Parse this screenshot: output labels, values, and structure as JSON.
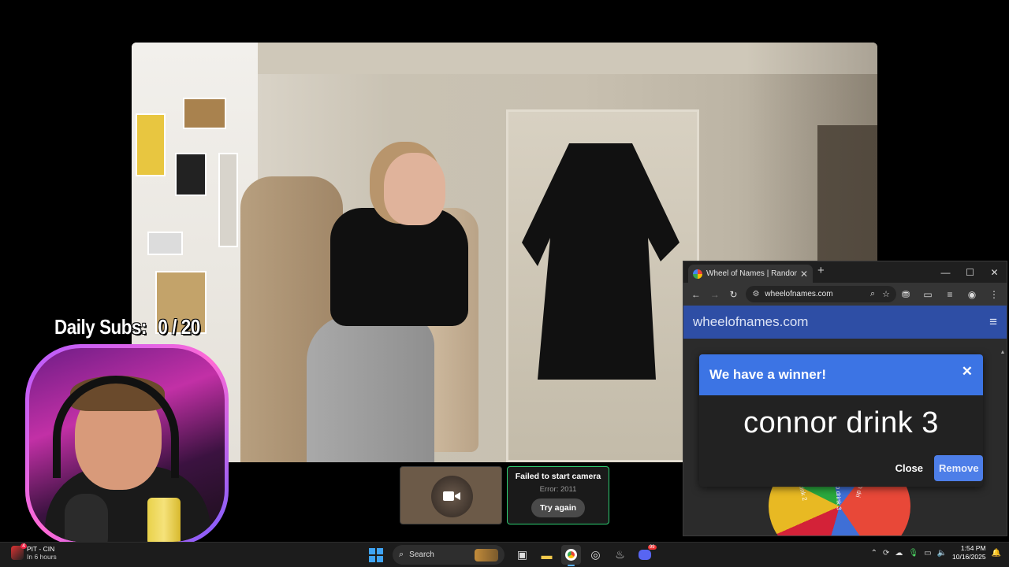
{
  "overlay": {
    "daily_subs_label": "Daily Subs:",
    "daily_subs_value": "0 / 20"
  },
  "camera_tiles": {
    "error_title": "Failed to start camera",
    "error_code": "Error: 2011",
    "try_again_label": "Try again"
  },
  "browser": {
    "tab_title": "Wheel of Names | Random nam",
    "url": "wheelofnames.com",
    "site_brand": "wheelofnames.com"
  },
  "wheel_labels": [
    "drink 2",
    "no drink 3",
    "sh dri"
  ],
  "modal": {
    "title": "We have a winner!",
    "winner": "connor drink 3",
    "close_label": "Close",
    "remove_label": "Remove"
  },
  "taskbar": {
    "weather_title": "PIT - CIN",
    "weather_sub": "In 6 hours",
    "search_placeholder": "Search",
    "discord_badge": "99",
    "time": "1:54 PM",
    "date": "10/16/2025"
  },
  "colors": {
    "site_header": "#2e4ea5",
    "modal_header": "#3c74e4",
    "remove_button": "#4d7ee8",
    "camera_error_border": "#2ecc71",
    "facecam_border": "#b45bff"
  }
}
